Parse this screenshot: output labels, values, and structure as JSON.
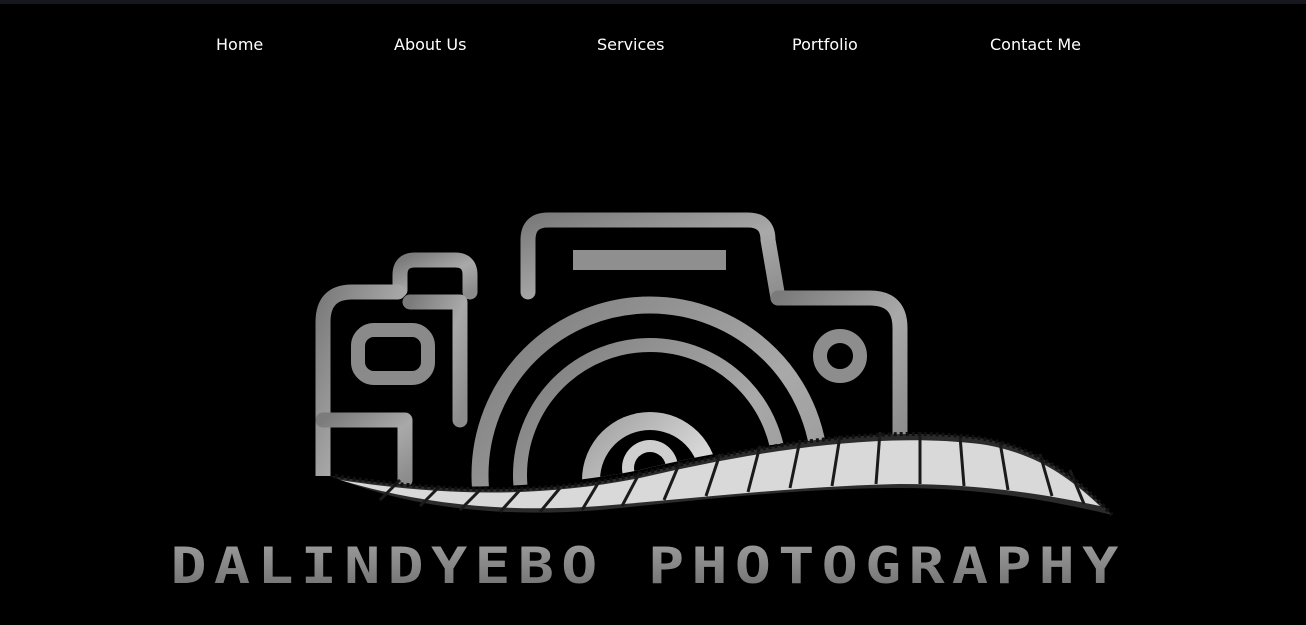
{
  "nav": {
    "items": [
      {
        "label": "Home"
      },
      {
        "label": "About Us"
      },
      {
        "label": "Services"
      },
      {
        "label": "Portfolio"
      },
      {
        "label": "Contact Me"
      }
    ]
  },
  "hero": {
    "logo_icon": "camera-icon",
    "logo_text": "DALINDYEBO PHOTOGRAPHY"
  },
  "colors": {
    "background": "#000000",
    "nav_text": "#ffffff",
    "logo_gray": "#8a8a8a"
  }
}
